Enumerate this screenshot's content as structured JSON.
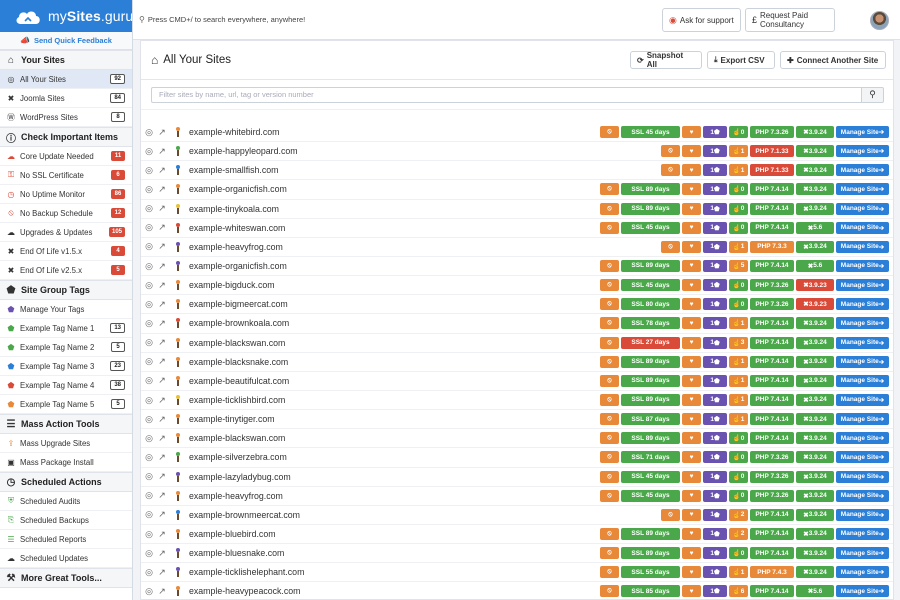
{
  "brand": {
    "name_plain": "my",
    "name_bold": "Sites",
    "name_suffix": ".guru"
  },
  "feedback_label": "Send Quick Feedback",
  "topbar": {
    "search_hint": "Press CMD+/ to search everywhere, anywhere!",
    "ask_support": "Ask for support",
    "paid_consult": "Request Paid Consultancy"
  },
  "sidebar": {
    "your_sites": {
      "title": "Your Sites",
      "items": [
        {
          "label": "All Your Sites",
          "count": "92",
          "icon": "globe-icon"
        },
        {
          "label": "Joomla Sites",
          "count": "84",
          "icon": "joomla-icon"
        },
        {
          "label": "WordPress Sites",
          "count": "8",
          "icon": "wordpress-icon"
        }
      ]
    },
    "important": {
      "title": "Check Important Items",
      "items": [
        {
          "label": "Core Update Needed",
          "count": "11",
          "icon": "cloud-icon"
        },
        {
          "label": "No SSL Certificate",
          "count": "6",
          "icon": "unlock-icon"
        },
        {
          "label": "No Uptime Monitor",
          "count": "86",
          "icon": "clock-icon"
        },
        {
          "label": "No Backup Schedule",
          "count": "12",
          "icon": "ban-icon"
        },
        {
          "label": "Upgrades & Updates",
          "count": "105",
          "icon": "cloud-upload-icon"
        },
        {
          "label": "End Of Life v1.5.x",
          "count": "4",
          "icon": "joomla-icon"
        },
        {
          "label": "End Of Life v2.5.x",
          "count": "5",
          "icon": "joomla-icon"
        }
      ]
    },
    "tags": {
      "title": "Site Group Tags",
      "items": [
        {
          "label": "Manage Your Tags",
          "count": "",
          "icon": "tag-icon"
        },
        {
          "label": "Example Tag Name 1",
          "count": "13",
          "icon": "tag-icon"
        },
        {
          "label": "Example Tag Name 2",
          "count": "5",
          "icon": "tag-icon"
        },
        {
          "label": "Example Tag Name 3",
          "count": "23",
          "icon": "tag-icon"
        },
        {
          "label": "Example Tag Name 4",
          "count": "38",
          "icon": "tag-icon"
        },
        {
          "label": "Example Tag Name 5",
          "count": "5",
          "icon": "tag-icon"
        }
      ]
    },
    "mass": {
      "title": "Mass Action Tools",
      "items": [
        {
          "label": "Mass Upgrade Sites",
          "count": "",
          "icon": "upgrade-icon"
        },
        {
          "label": "Mass Package Install",
          "count": "",
          "icon": "package-icon"
        }
      ]
    },
    "scheduled": {
      "title": "Scheduled Actions",
      "items": [
        {
          "label": "Scheduled Audits",
          "count": "",
          "icon": "shield-icon"
        },
        {
          "label": "Scheduled Backups",
          "count": "",
          "icon": "copy-icon"
        },
        {
          "label": "Scheduled Reports",
          "count": "",
          "icon": "report-icon"
        },
        {
          "label": "Scheduled Updates",
          "count": "",
          "icon": "cloud-upload-icon"
        }
      ]
    },
    "more": {
      "title": "More Great Tools..."
    }
  },
  "main": {
    "title": "All Your Sites",
    "snapshot": "Snapshot All",
    "export": "Export CSV",
    "connect": "Connect Another Site",
    "filter_placeholder": "Filter sites by name, url, tag or version number",
    "manage_label": "Manage Site"
  },
  "colors": {
    "accent": "#2b7fd6",
    "green": "#4aa84a",
    "red": "#d94a38",
    "orange": "#e8893a",
    "purple": "#6a52b0"
  },
  "sites": [
    {
      "name": "example-whitebird.com",
      "ssl": "SSL 45 days",
      "ssl_status": "green",
      "tags": "1",
      "plug": "0",
      "plug_status": "green",
      "php": "PHP 7.3.26",
      "php_status": "green",
      "ver": "3.9.24",
      "ver_status": "green",
      "fav": "#e8893a"
    },
    {
      "name": "example-happyleopard.com",
      "ssl": "",
      "ssl_status": "",
      "tags": "1",
      "plug": "1",
      "plug_status": "orange",
      "php": "PHP 7.1.33",
      "php_status": "red",
      "ver": "3.9.24",
      "ver_status": "green",
      "fav": "#4aa84a"
    },
    {
      "name": "example-smallfish.com",
      "ssl": "",
      "ssl_status": "",
      "tags": "1",
      "plug": "1",
      "plug_status": "orange",
      "php": "PHP 7.1.33",
      "php_status": "red",
      "ver": "3.9.24",
      "ver_status": "green",
      "fav": "#2b7fd6"
    },
    {
      "name": "example-organicfish.com",
      "ssl": "SSL 89 days",
      "ssl_status": "green",
      "tags": "1",
      "plug": "0",
      "plug_status": "green",
      "php": "PHP 7.4.14",
      "php_status": "green",
      "ver": "3.9.24",
      "ver_status": "green",
      "fav": "#e8893a"
    },
    {
      "name": "example-tinykoala.com",
      "ssl": "SSL 89 days",
      "ssl_status": "green",
      "tags": "1",
      "plug": "0",
      "plug_status": "green",
      "php": "PHP 7.4.14",
      "php_status": "green",
      "ver": "3.9.24",
      "ver_status": "green",
      "fav": "#e8c23a"
    },
    {
      "name": "example-whiteswan.com",
      "ssl": "SSL 45 days",
      "ssl_status": "green",
      "tags": "1",
      "plug": "0",
      "plug_status": "green",
      "php": "PHP 7.4.14",
      "php_status": "green",
      "ver": "5.6",
      "ver_status": "green",
      "fav": "#d94a38"
    },
    {
      "name": "example-heavyfrog.com",
      "ssl": "",
      "ssl_status": "",
      "tags": "1",
      "plug": "1",
      "plug_status": "orange",
      "php": "PHP 7.3.3",
      "php_status": "orange",
      "ver": "3.9.24",
      "ver_status": "green",
      "fav": "#6a52b0"
    },
    {
      "name": "example-organicfish.com",
      "ssl": "SSL 89 days",
      "ssl_status": "green",
      "tags": "1",
      "plug": "5",
      "plug_status": "orange",
      "php": "PHP 7.4.14",
      "php_status": "green",
      "ver": "5.6",
      "ver_status": "green",
      "fav": "#6a52b0"
    },
    {
      "name": "example-bigduck.com",
      "ssl": "SSL 45 days",
      "ssl_status": "green",
      "tags": "1",
      "plug": "0",
      "plug_status": "green",
      "php": "PHP 7.3.26",
      "php_status": "green",
      "ver": "3.9.23",
      "ver_status": "red",
      "fav": "#e8893a"
    },
    {
      "name": "example-bigmeercat.com",
      "ssl": "SSL 80 days",
      "ssl_status": "green",
      "tags": "1",
      "plug": "0",
      "plug_status": "green",
      "php": "PHP 7.3.26",
      "php_status": "green",
      "ver": "3.9.23",
      "ver_status": "red",
      "fav": "#e8893a"
    },
    {
      "name": "example-brownkoala.com",
      "ssl": "SSL 78 days",
      "ssl_status": "green",
      "tags": "1",
      "plug": "1",
      "plug_status": "orange",
      "php": "PHP 7.4.14",
      "php_status": "green",
      "ver": "3.9.24",
      "ver_status": "green",
      "fav": "#d94a38"
    },
    {
      "name": "example-blackswan.com",
      "ssl": "SSL 27 days",
      "ssl_status": "red",
      "tags": "1",
      "plug": "3",
      "plug_status": "orange",
      "php": "PHP 7.4.14",
      "php_status": "green",
      "ver": "3.9.24",
      "ver_status": "green",
      "fav": "#e8893a"
    },
    {
      "name": "example-blacksnake.com",
      "ssl": "SSL 89 days",
      "ssl_status": "green",
      "tags": "1",
      "plug": "1",
      "plug_status": "orange",
      "php": "PHP 7.4.14",
      "php_status": "green",
      "ver": "3.9.24",
      "ver_status": "green",
      "fav": "#e8893a"
    },
    {
      "name": "example-beautifulcat.com",
      "ssl": "SSL 89 days",
      "ssl_status": "green",
      "tags": "1",
      "plug": "1",
      "plug_status": "orange",
      "php": "PHP 7.4.14",
      "php_status": "green",
      "ver": "3.9.24",
      "ver_status": "green",
      "fav": "#e8893a"
    },
    {
      "name": "example-ticklishbird.com",
      "ssl": "SSL 89 days",
      "ssl_status": "green",
      "tags": "1",
      "plug": "1",
      "plug_status": "orange",
      "php": "PHP 7.4.14",
      "php_status": "green",
      "ver": "3.9.24",
      "ver_status": "green",
      "fav": "#e8c23a"
    },
    {
      "name": "example-tinytiger.com",
      "ssl": "SSL 87 days",
      "ssl_status": "green",
      "tags": "1",
      "plug": "1",
      "plug_status": "orange",
      "php": "PHP 7.4.14",
      "php_status": "green",
      "ver": "3.9.24",
      "ver_status": "green",
      "fav": "#e8893a"
    },
    {
      "name": "example-blackswan.com",
      "ssl": "SSL 89 days",
      "ssl_status": "green",
      "tags": "1",
      "plug": "0",
      "plug_status": "green",
      "php": "PHP 7.4.14",
      "php_status": "green",
      "ver": "3.9.24",
      "ver_status": "green",
      "fav": "#e8893a"
    },
    {
      "name": "example-silverzebra.com",
      "ssl": "SSL 71 days",
      "ssl_status": "green",
      "tags": "1",
      "plug": "0",
      "plug_status": "green",
      "php": "PHP 7.3.26",
      "php_status": "green",
      "ver": "3.9.24",
      "ver_status": "green",
      "fav": "#4aa84a"
    },
    {
      "name": "example-lazyladybug.com",
      "ssl": "SSL 45 days",
      "ssl_status": "green",
      "tags": "1",
      "plug": "0",
      "plug_status": "green",
      "php": "PHP 7.3.26",
      "php_status": "green",
      "ver": "3.9.24",
      "ver_status": "green",
      "fav": "#6a52b0"
    },
    {
      "name": "example-heavyfrog.com",
      "ssl": "SSL 45 days",
      "ssl_status": "green",
      "tags": "1",
      "plug": "0",
      "plug_status": "green",
      "php": "PHP 7.3.26",
      "php_status": "green",
      "ver": "3.9.24",
      "ver_status": "green",
      "fav": "#e8893a"
    },
    {
      "name": "example-brownmeercat.com",
      "ssl": "",
      "ssl_status": "",
      "tags": "1",
      "plug": "2",
      "plug_status": "orange",
      "php": "PHP 7.4.14",
      "php_status": "green",
      "ver": "3.9.24",
      "ver_status": "green",
      "fav": "#2b7fd6"
    },
    {
      "name": "example-bluebird.com",
      "ssl": "SSL 89 days",
      "ssl_status": "green",
      "tags": "1",
      "plug": "2",
      "plug_status": "orange",
      "php": "PHP 7.4.14",
      "php_status": "green",
      "ver": "3.9.24",
      "ver_status": "green",
      "fav": "#e8893a"
    },
    {
      "name": "example-bluesnake.com",
      "ssl": "SSL 89 days",
      "ssl_status": "green",
      "tags": "1",
      "plug": "0",
      "plug_status": "green",
      "php": "PHP 7.4.14",
      "php_status": "green",
      "ver": "3.9.24",
      "ver_status": "green",
      "fav": "#6a52b0"
    },
    {
      "name": "example-ticklishelephant.com",
      "ssl": "SSL 55 days",
      "ssl_status": "green",
      "tags": "1",
      "plug": "1",
      "plug_status": "orange",
      "php": "PHP 7.4.3",
      "php_status": "orange",
      "ver": "3.9.24",
      "ver_status": "green",
      "fav": "#6a52b0"
    },
    {
      "name": "example-heavypeacock.com",
      "ssl": "SSL 85 days",
      "ssl_status": "green",
      "tags": "1",
      "plug": "6",
      "plug_status": "orange",
      "php": "PHP 7.4.14",
      "php_status": "green",
      "ver": "5.6",
      "ver_status": "green",
      "fav": "#e8893a"
    }
  ]
}
